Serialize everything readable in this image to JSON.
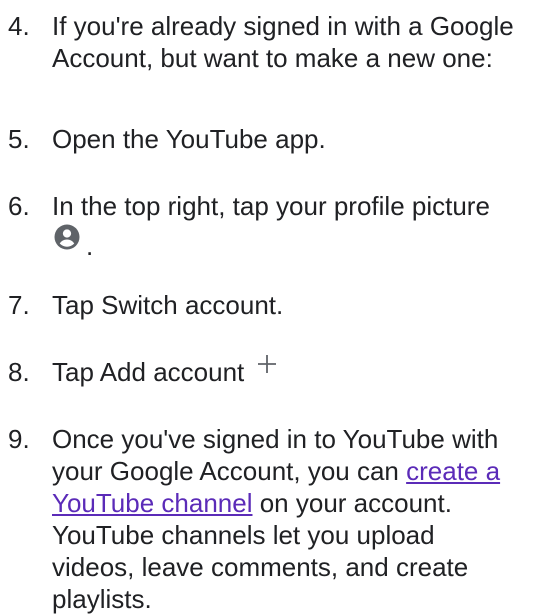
{
  "steps": [
    {
      "number": "4.",
      "text": "If you're already signed in with a Google Account, but want to make a new one:"
    },
    {
      "number": "5.",
      "text": "Open the YouTube app."
    },
    {
      "number": "6.",
      "text": "In the top right, tap your profile picture",
      "icon": "account-circle-icon",
      "after_icon": "."
    },
    {
      "number": "7.",
      "text": "Tap Switch account."
    },
    {
      "number": "8.",
      "text": "Tap Add account",
      "icon": "plus-icon"
    },
    {
      "number": "9.",
      "text_before_link": "Once you've signed in to YouTube with your Google Account, you can",
      "link_text": "create a YouTube channel",
      "text_after_link": "on your account. YouTube channels let you upload videos, leave comments, and create playlists."
    }
  ],
  "colors": {
    "text": "#202124",
    "link": "#5b2bb8",
    "icon": "#5f6368"
  }
}
